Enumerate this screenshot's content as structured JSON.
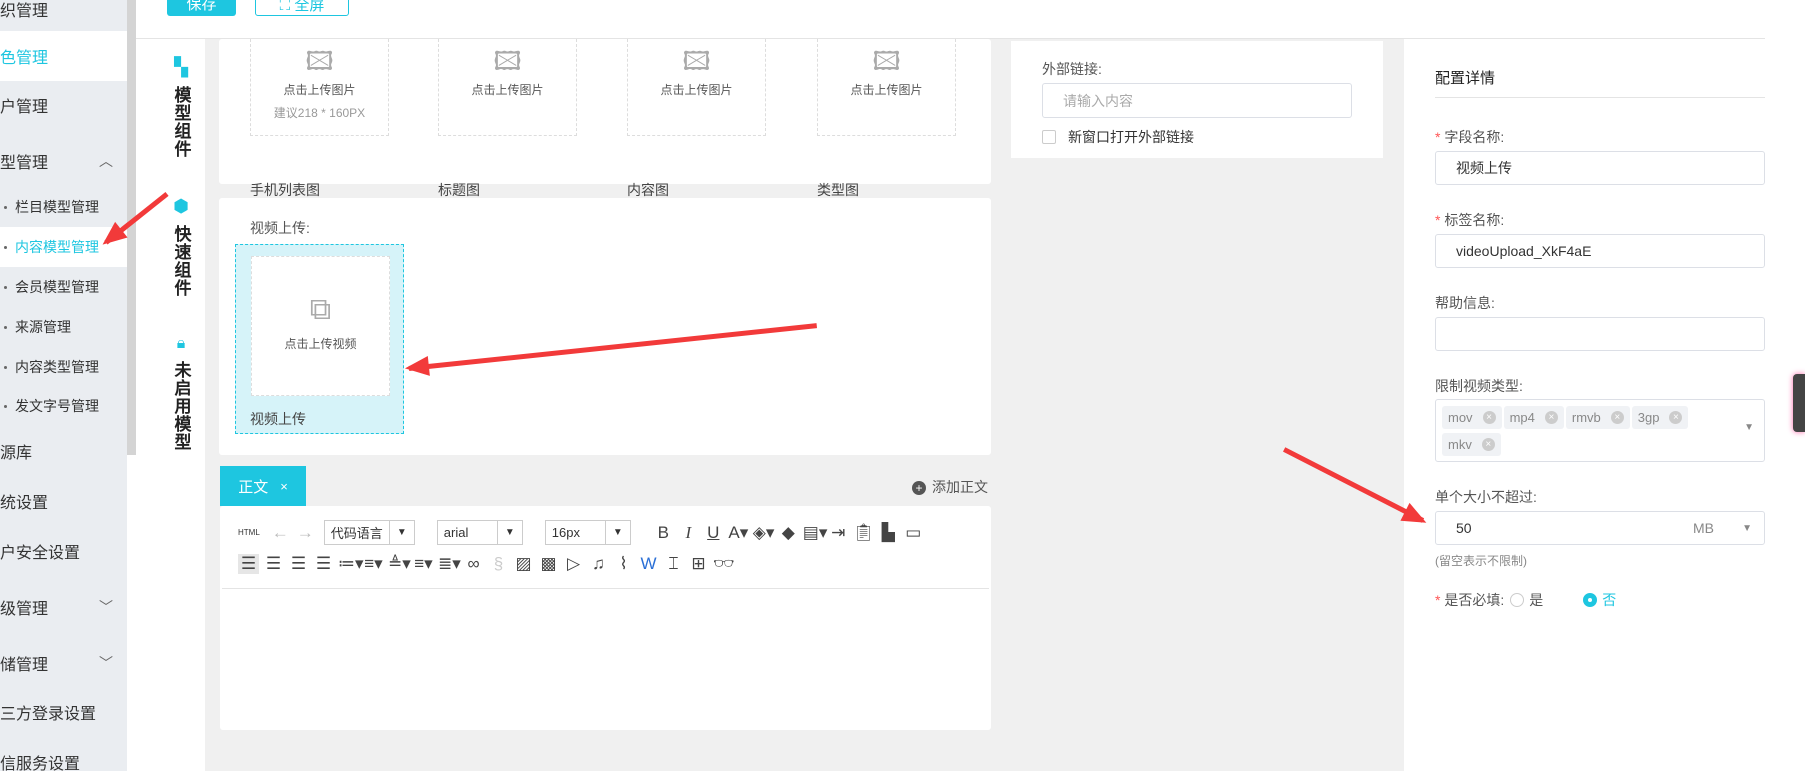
{
  "sidebar": {
    "items": [
      {
        "label": "织管理"
      },
      {
        "label": "色管理"
      },
      {
        "label": "户管理"
      },
      {
        "label": "型管理"
      },
      {
        "label": "栏目模型管理"
      },
      {
        "label": "内容模型管理"
      },
      {
        "label": "会员模型管理"
      },
      {
        "label": "来源管理"
      },
      {
        "label": "内容类型管理"
      },
      {
        "label": "发文字号管理"
      },
      {
        "label": "源库"
      },
      {
        "label": "统设置"
      },
      {
        "label": "户安全设置"
      },
      {
        "label": "级管理"
      },
      {
        "label": "储管理"
      },
      {
        "label": "三方登录设置"
      },
      {
        "label": "信服务设置"
      }
    ]
  },
  "toolbar": {
    "save": "保存",
    "fullscreen": "全屏"
  },
  "vstrip": {
    "groups": [
      {
        "label": "模型组件"
      },
      {
        "label": "快速组件"
      },
      {
        "label": "未启用模型"
      }
    ]
  },
  "images": {
    "upload_text": "点击上传图片",
    "hint": "建议218 * 160PX",
    "items": [
      {
        "label": "手机列表图"
      },
      {
        "label": "标题图"
      },
      {
        "label": "内容图"
      },
      {
        "label": "类型图"
      }
    ]
  },
  "video": {
    "label": "视频上传:",
    "upload_text": "点击上传视频",
    "caption": "视频上传"
  },
  "external": {
    "label": "外部链接:",
    "placeholder": "请输入内容",
    "checkbox": "新窗口打开外部链接"
  },
  "editor": {
    "tab": "正文",
    "tab_close": "×",
    "add": "添加正文",
    "html": "HTML",
    "code_lang": "代码语言",
    "font": "arial",
    "size": "16px"
  },
  "config": {
    "title": "配置详情",
    "field_name_label": "字段名称:",
    "field_name": "视频上传",
    "tag_name_label": "标签名称:",
    "tag_name": "videoUpload_XkF4aE",
    "help_label": "帮助信息:",
    "help": "",
    "types_label": "限制视频类型:",
    "types": [
      "mov",
      "mp4",
      "rmvb",
      "3gp",
      "mkv"
    ],
    "size_label": "单个大小不超过:",
    "size": "50",
    "size_unit": "MB",
    "size_hint": "(留空表示不限制)",
    "required_label": "是否必填:",
    "yes": "是",
    "no": "否",
    "required": "否"
  },
  "colors": {
    "accent": "#1ec6e0",
    "annotation": "#f23a3a"
  }
}
